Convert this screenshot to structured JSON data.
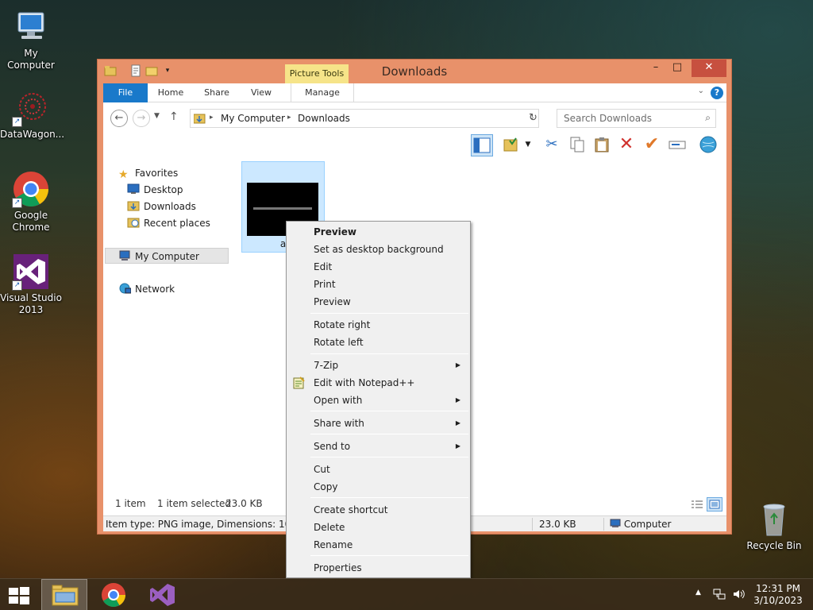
{
  "desktop": {
    "icons": [
      {
        "label": "My Computer"
      },
      {
        "label": "DataWagon..."
      },
      {
        "label": "Google Chrome"
      },
      {
        "label": "Visual Studio 2013"
      },
      {
        "label": "Recycle Bin"
      }
    ]
  },
  "window": {
    "title": "Downloads",
    "contextual_tab_group": "Picture Tools",
    "ribbon_tabs": [
      "File",
      "Home",
      "Share",
      "View",
      "Manage"
    ],
    "buttons": {
      "minimize": "–",
      "maximize": "□",
      "close": "✕"
    },
    "address": {
      "crumbs": [
        "My Computer",
        "Downloads"
      ]
    },
    "search_placeholder": "Search Downloads",
    "nav": {
      "favorites": "Favorites",
      "desktop": "Desktop",
      "downloads": "Downloads",
      "recent": "Recent places",
      "my_computer": "My Computer",
      "network": "Network"
    },
    "file": {
      "name": "a",
      "type": "PNG image"
    },
    "status": {
      "items": "1 item",
      "selected": "1 item selected",
      "size": "23.0 KB"
    },
    "details": {
      "info": "Item type: PNG image, Dimensions: 1024 x 7",
      "size": "23.0 KB",
      "location": "Computer"
    }
  },
  "context_menu": {
    "items": [
      {
        "label": "Preview",
        "bold": true
      },
      {
        "label": "Set as desktop background"
      },
      {
        "label": "Edit"
      },
      {
        "label": "Print"
      },
      {
        "label": "Preview"
      },
      {
        "label": "Rotate right"
      },
      {
        "label": "Rotate left"
      },
      {
        "label": "7-Zip",
        "submenu": true
      },
      {
        "label": "Edit with Notepad++"
      },
      {
        "label": "Open with",
        "submenu": true
      },
      {
        "label": "Share with",
        "submenu": true
      },
      {
        "label": "Send to",
        "submenu": true
      },
      {
        "label": "Cut"
      },
      {
        "label": "Copy"
      },
      {
        "label": "Create shortcut"
      },
      {
        "label": "Delete"
      },
      {
        "label": "Rename"
      },
      {
        "label": "Properties"
      }
    ]
  },
  "taskbar": {
    "apps": [
      "File Explorer",
      "Google Chrome",
      "Visual Studio 2013"
    ],
    "clock": {
      "time": "12:31 PM",
      "date": "3/10/2023"
    }
  }
}
